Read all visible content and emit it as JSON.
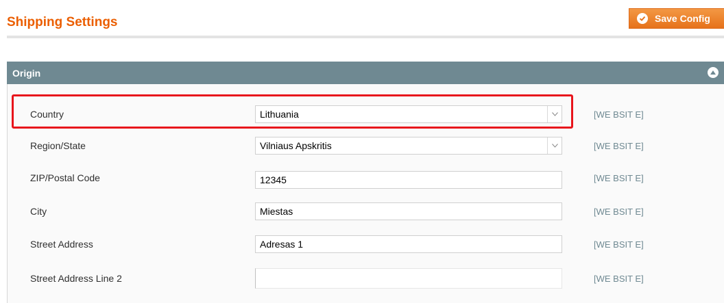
{
  "page": {
    "title": "Shipping Settings"
  },
  "toolbar": {
    "save_label": "Save Config"
  },
  "section": {
    "title": "Origin"
  },
  "fields": [
    {
      "label": "Country",
      "type": "select",
      "value": "Lithuania",
      "scope": "[WE BSIT E]"
    },
    {
      "label": "Region/State",
      "type": "select",
      "value": "Vilniaus Apskritis",
      "scope": "[WE BSIT E]"
    },
    {
      "label": "ZIP/Postal Code",
      "type": "text",
      "value": "12345",
      "scope": "[WE BSIT E]"
    },
    {
      "label": "City",
      "type": "text",
      "value": "Miestas",
      "scope": "[WE BSIT E]"
    },
    {
      "label": "Street Address",
      "type": "text",
      "value": "Adresas 1",
      "scope": "[WE BSIT E]"
    },
    {
      "label": "Street Address Line 2",
      "type": "text",
      "value": "",
      "scope": "[WE BSIT E]"
    }
  ],
  "colors": {
    "title": "#eb5e00",
    "save_button": "#e6721b",
    "section_header": "#6f8992",
    "scope_text": "#6f8992",
    "highlight": "#e8141b"
  },
  "icons": {
    "save": "check-circle-icon",
    "collapse": "chevron-up-circle-icon",
    "select": "chevron-down-icon"
  }
}
